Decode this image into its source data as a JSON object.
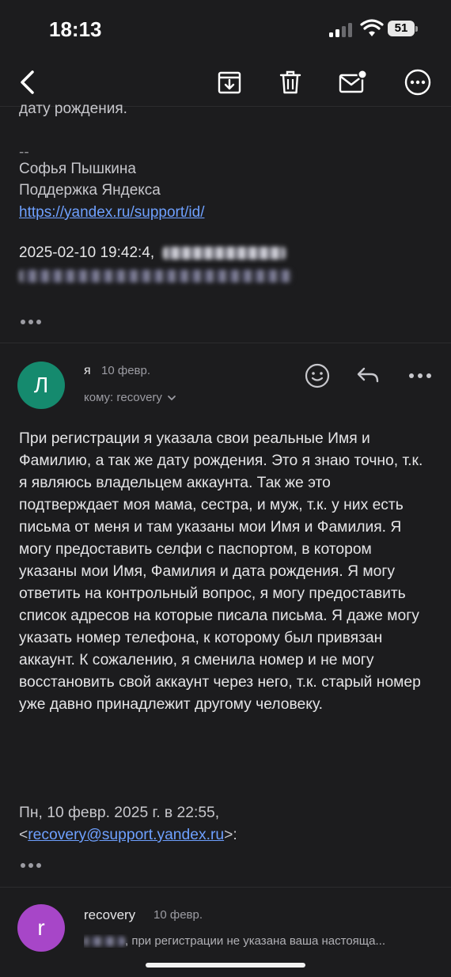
{
  "status": {
    "time": "18:13",
    "battery": "51"
  },
  "toolbar": {
    "back_icon": "chevron-left-icon",
    "archive_icon": "archive-download-icon",
    "delete_icon": "trash-icon",
    "unread_icon": "mail-unread-icon",
    "more_icon": "more-circle-icon"
  },
  "previous_message": {
    "cut_line": "дату рождения.",
    "separator": "--",
    "signature_name": "Софья Пышкина",
    "signature_team": "Поддержка Яндекса",
    "signature_link": "https://yandex.ru/support/id/",
    "quote_header": "2025-02-10 19:42:4,"
  },
  "message": {
    "avatar_letter": "Л",
    "sender": "я",
    "date": "10 февр.",
    "to_label": "кому: recovery",
    "body": "При регистрации я указала свои реальные Имя и Фамилию, а так же дату рождения. Это я знаю точно, т.к. я являюсь владельцем аккаунта. Так же это подтверждает моя мама, сестра, и муж, т.к. у них есть письма от меня и там указаны мои Имя и Фамилия. Я могу предоставить селфи с паспортом, в котором указаны мои Имя, Фамилия и дата рождения. Я могу ответить на контрольный вопрос, я могу предоставить список адресов на которые писала письма. Я даже могу указать номер телефона, к которому был привязан аккаунт. К сожалению, я сменила номер и не могу восстановить свой аккаунт через него, т.к. старый номер уже давно принадлежит другому человеку.",
    "quote_date": "Пн, 10 февр. 2025 г. в 22:55,",
    "quote_bracket_open": "<",
    "quote_email": "recovery@support.yandex.ru",
    "quote_bracket_close": ">:"
  },
  "next_message": {
    "avatar_letter": "r",
    "sender": "recovery",
    "date": "10 февр.",
    "preview": ", при регистрации не указана ваша настояща..."
  },
  "colors": {
    "background": "#1c1c1e",
    "link": "#6ea0ff",
    "avatar_l": "#158a6e",
    "avatar_r": "#a746c8"
  }
}
